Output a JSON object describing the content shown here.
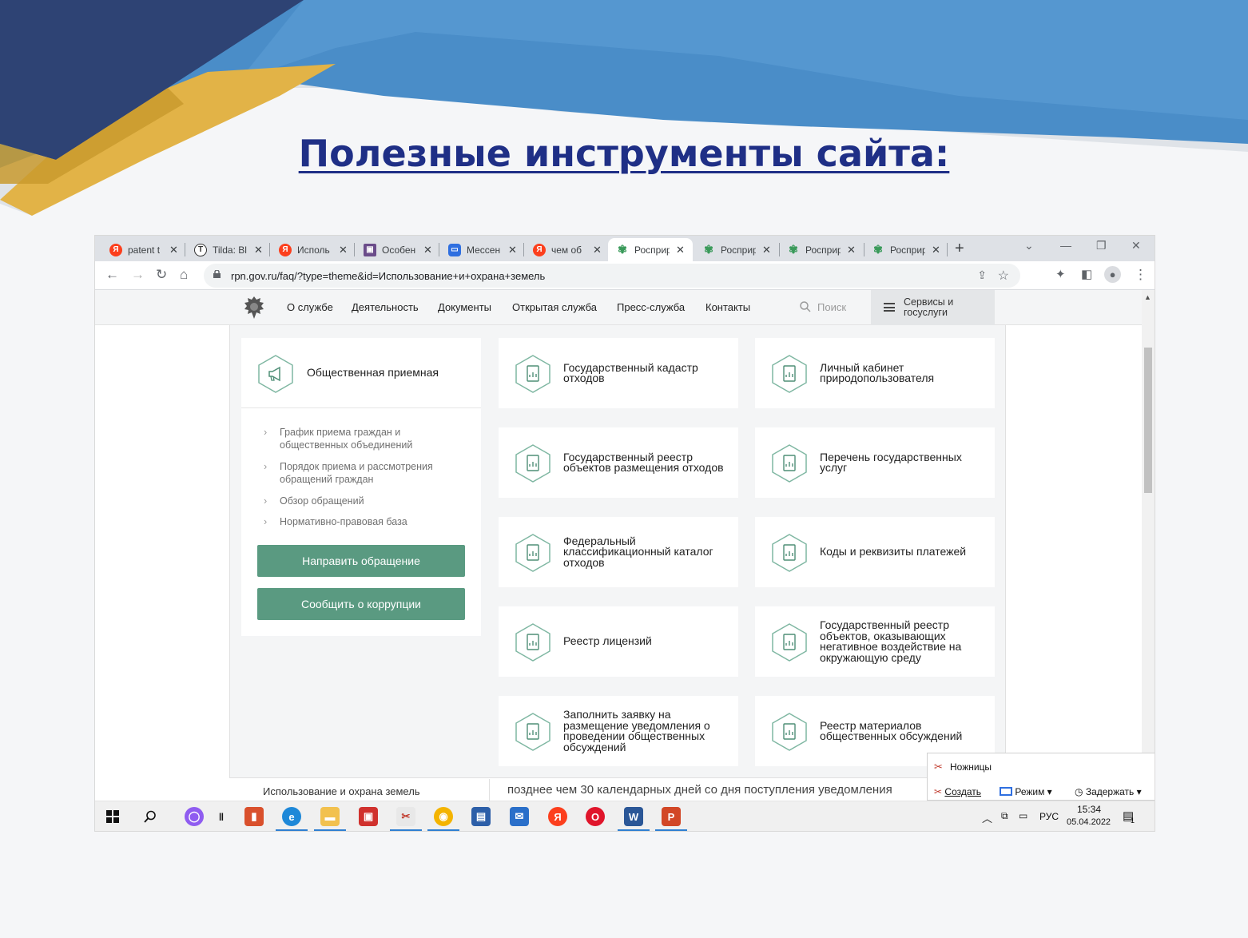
{
  "slide": {
    "title": "Полезные инструменты сайта:",
    "colors": {
      "navy": "#2b3b6e",
      "blue": "#3f85c4",
      "gold": "#e0ae3c",
      "title": "#1f2f86"
    }
  },
  "browser": {
    "tabs": [
      {
        "title": "patent t",
        "icon": "yandex-icon"
      },
      {
        "title": "Tilda: Bl",
        "icon": "tilda-icon"
      },
      {
        "title": "Исполь",
        "icon": "yandex-icon"
      },
      {
        "title": "Особен",
        "icon": "image-icon"
      },
      {
        "title": "Мессен",
        "icon": "messenger-icon"
      },
      {
        "title": "чем об",
        "icon": "yandex-icon"
      },
      {
        "title": "Росприр",
        "icon": "rpn-icon"
      },
      {
        "title": "Росприр",
        "icon": "rpn-icon"
      },
      {
        "title": "Росприр",
        "icon": "rpn-icon"
      },
      {
        "title": "Росприр",
        "icon": "rpn-icon"
      }
    ],
    "active_tab": 6,
    "url": "rpn.gov.ru/faq/?type=theme&id=Использование+и+охрана+земель"
  },
  "site": {
    "nav": [
      "О службе",
      "Деятельность",
      "Документы",
      "Открытая служба",
      "Пресс-служба",
      "Контакты"
    ],
    "search_placeholder": "Поиск",
    "services_label": "Сервисы и госуслуги",
    "reception": {
      "title": "Общественная приемная",
      "links": [
        "График приема граждан и общественных объединений",
        "Порядок приема и рассмотрения обращений граждан",
        "Обзор обращений",
        "Нормативно-правовая база"
      ],
      "buttons": [
        "Направить обращение",
        "Сообщить о коррупции"
      ]
    },
    "cards": [
      "Государственный кадастр отходов",
      "Личный кабинет природопользователя",
      "Государственный реестр объектов размещения отходов",
      "Перечень государственных услуг",
      "Федеральный классификационный каталог отходов",
      "Коды и реквизиты платежей",
      "Реестр лицензий",
      "Государственный реестр объектов, оказывающих негативное воздействие на окружающую среду",
      "Заполнить заявку на размещение уведомления о проведении общественных обсуждений",
      "Реестр материалов общественных обсуждений"
    ],
    "below_left": "Использование и охрана земель",
    "below_right": "позднее чем 30 календарных дней со дня поступления уведомления"
  },
  "snipping_tool": {
    "title": "Ножницы",
    "create": "Создать",
    "mode": "Режим",
    "delay": "Задержать"
  },
  "taskbar": {
    "apps": [
      "alice",
      "task-view",
      "bookmark-app",
      "edge",
      "explorer",
      "reader",
      "snipping",
      "chrome",
      "store",
      "mail",
      "yandex-browser",
      "opera",
      "word",
      "powerpoint"
    ],
    "lang": "РУС",
    "time": "15:34",
    "date": "05.04.2022",
    "notif_count": "1"
  },
  "theme": {
    "accent_green": "#5a9a81"
  }
}
